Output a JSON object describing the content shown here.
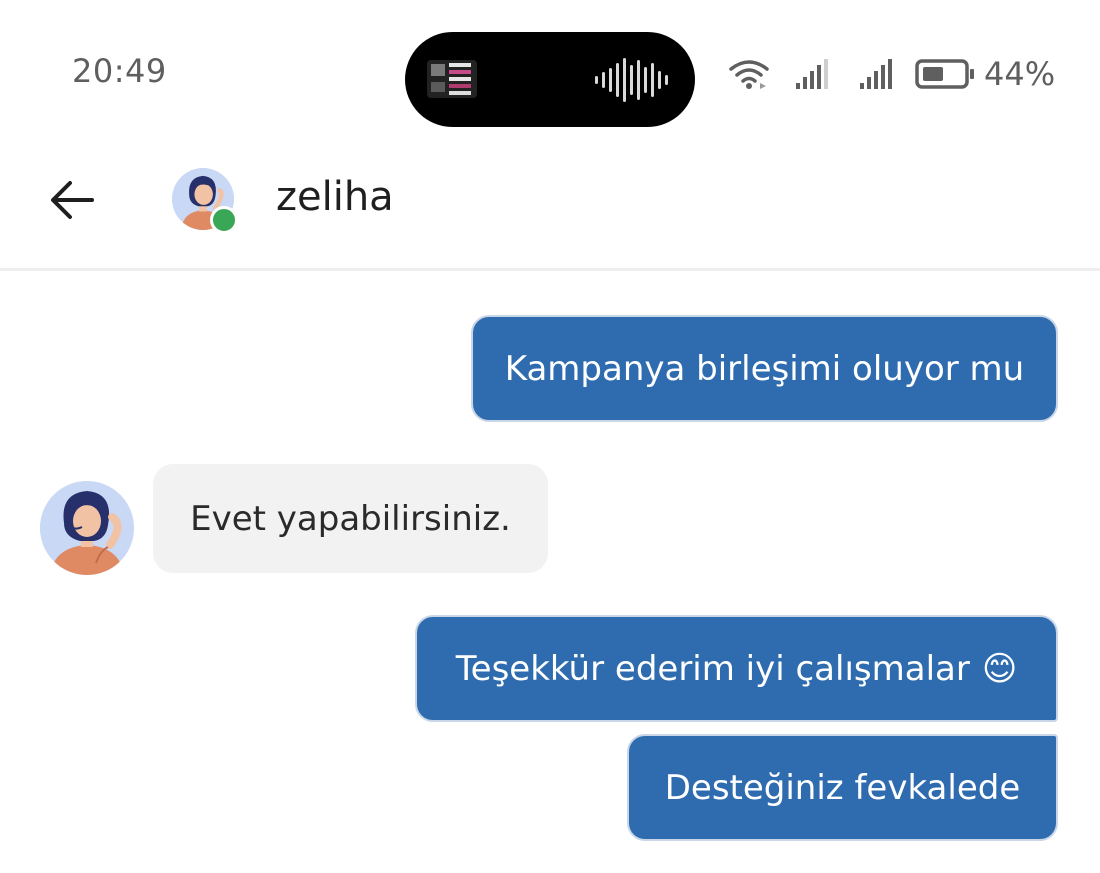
{
  "status_bar": {
    "time": "20:49",
    "battery_percent": "44%",
    "battery_level": 0.44,
    "icons": [
      "wifi-icon",
      "signal-icon",
      "signal-icon",
      "battery-icon"
    ]
  },
  "header": {
    "back_icon": "arrow-left-icon",
    "contact_name": "zeliha",
    "online": true
  },
  "messages": [
    {
      "direction": "outgoing",
      "text": "Kampanya birleşimi oluyor mu"
    },
    {
      "direction": "incoming",
      "text": "Evet yapabilirsiniz."
    },
    {
      "direction": "outgoing",
      "text": "Teşekkür ederim iyi çalışmalar",
      "emoji": "😊"
    },
    {
      "direction": "outgoing",
      "text": "Desteğiniz fevkalede"
    }
  ],
  "colors": {
    "outgoing_bubble": "#2f6caf",
    "incoming_bubble": "#f2f2f2",
    "online_dot": "#3aa757"
  }
}
